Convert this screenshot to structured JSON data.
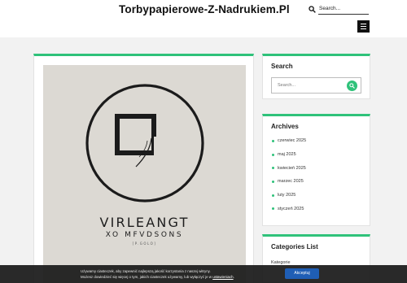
{
  "header": {
    "site_title": "Torbypapierowe-Z-Nadrukiem.Pl",
    "search_placeholder": "Search..."
  },
  "post": {
    "logo_line1": "VIRLEANGT",
    "logo_line2": "XO MFVDSONS",
    "logo_line3": "[P.GOLO]"
  },
  "sidebar": {
    "search": {
      "title": "Search",
      "placeholder": "Search..."
    },
    "archives": {
      "title": "Archives",
      "items": [
        "czerwiec 2025",
        "maj 2025",
        "kwiecień 2025",
        "marzec 2025",
        "luty 2025",
        "styczeń 2025"
      ]
    },
    "categories": {
      "title": "Categories List",
      "items": [
        "Kategorie"
      ]
    }
  },
  "cookie": {
    "line1": "Używamy ciasteczek, aby zapewnić najlepszą jakość korzystania z naszej witryny.",
    "line2": "Możesz dowiedzieć się więcej o tym, jakich ciasteczek używamy, lub wyłączyć je w",
    "link": "ustawieniach",
    "line2_end": ".",
    "accept_label": "Akceptuj"
  },
  "colors": {
    "accent": "#2fc27a",
    "accept_button": "#1f5eb5",
    "banner_bg": "#1a1a1a"
  }
}
